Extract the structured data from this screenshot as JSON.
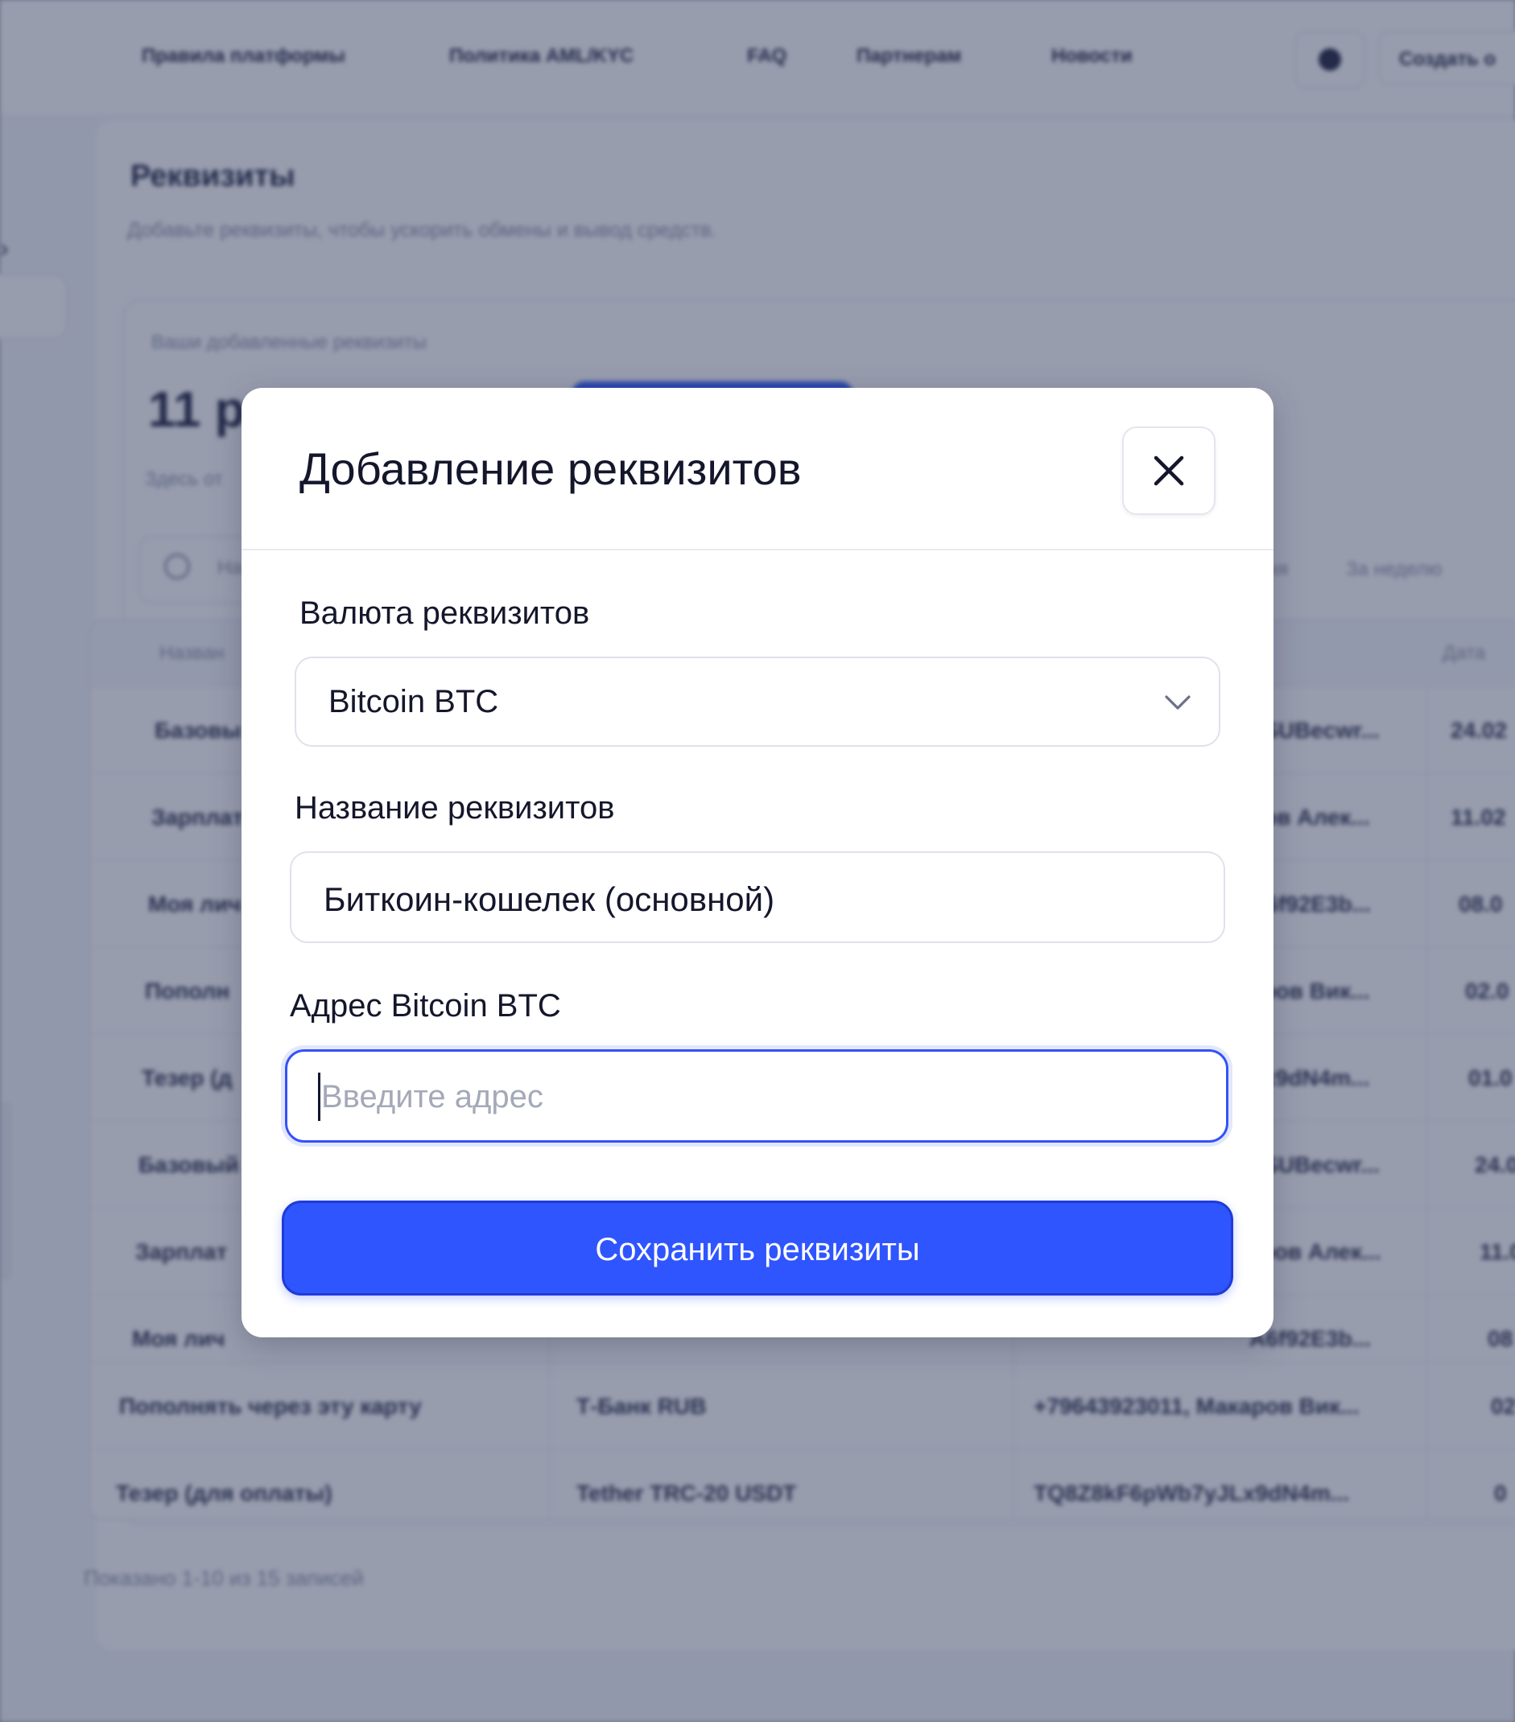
{
  "background": {
    "nav": {
      "links": [
        "Правила платформы",
        "Политика AML/KYC",
        "FAQ",
        "Партнерам",
        "Новости"
      ],
      "create_button": "Создать о"
    },
    "page": {
      "title": "Реквизиты",
      "subtitle": "Добавьте реквизиты, чтобы ускорить обмены и вывод средств."
    },
    "card": {
      "caption": "Ваши добавленные реквизиты",
      "count": "11 ре",
      "count_sub": "Здесь от",
      "search_placeholder": "На",
      "filters": [
        "дня",
        "За неделю"
      ]
    },
    "table": {
      "headers": [
        "Назван",
        "",
        "",
        "Дата"
      ],
      "rows": [
        [
          "Базовы",
          "",
          "LSUBecwr...",
          "24.02"
        ],
        [
          "Зарплат",
          "",
          "ров Алек...",
          "11.02"
        ],
        [
          "Моя лич",
          "",
          "A6f92E3b...",
          "08.0"
        ],
        [
          "Пополн",
          "",
          "аров Вик...",
          "02.0"
        ],
        [
          "Тезер (д",
          "",
          "Lx9dN4m...",
          "01.0"
        ],
        [
          "Базовый",
          "",
          "LSUBecwr...",
          "24.0"
        ],
        [
          "Зарплат",
          "",
          "тров Алек...",
          "11.0"
        ],
        [
          "Моя лич",
          "",
          "A6f92E3b...",
          "08"
        ],
        [
          "Пополнять через эту карту",
          "Т-Банк RUB",
          "+79643923011, Макаров Вик...",
          "02"
        ],
        [
          "Тезер (для оплаты)",
          "Tether TRC-20 USDT",
          "TQ8Z8kF6pWb7yJLx9dN4m...",
          "0"
        ]
      ]
    },
    "footer": "Показано 1-10 из 15 записей"
  },
  "modal": {
    "title": "Добавление реквизитов",
    "close_icon": "close-icon",
    "currency": {
      "label": "Валюта реквизитов",
      "selected": "Bitcoin BTC",
      "icon": "chevron-down-icon"
    },
    "name": {
      "label": "Название реквизитов",
      "value": "Биткоин-кошелек (основной)"
    },
    "address": {
      "label": "Адрес Bitcoin BTC",
      "placeholder": "Введите адрес",
      "value": ""
    },
    "save_button": "Сохранить реквизиты"
  },
  "colors": {
    "accent": "#2f55ff",
    "focus_border": "#3452f7",
    "overlay": "rgba(40,50,85,0.48)",
    "text_primary": "#14172b",
    "placeholder": "#a4a9b8"
  }
}
